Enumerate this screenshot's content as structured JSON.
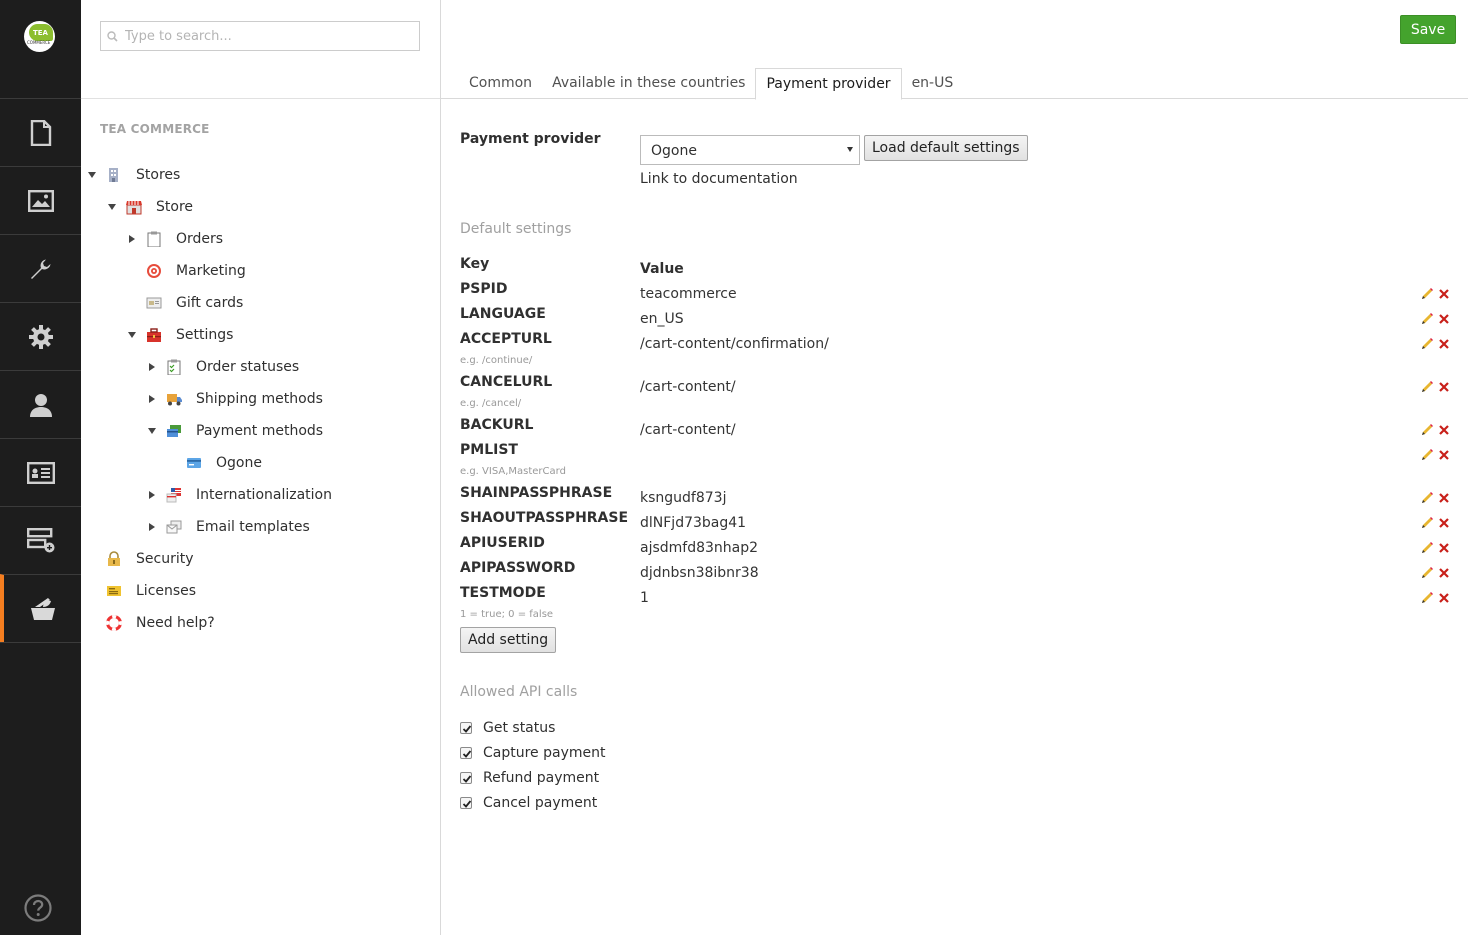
{
  "appbar": {
    "logo_text_top": "TEA",
    "logo_text_bottom": "COMMERCE",
    "items": [
      {
        "name": "content",
        "icon": "document-icon"
      },
      {
        "name": "media",
        "icon": "image-icon"
      },
      {
        "name": "developer",
        "icon": "wrench-icon"
      },
      {
        "name": "settings",
        "icon": "gear-icon"
      },
      {
        "name": "users",
        "icon": "user-icon"
      },
      {
        "name": "members",
        "icon": "id-card-icon"
      },
      {
        "name": "forms",
        "icon": "form-add-icon"
      },
      {
        "name": "tea-commerce",
        "icon": "tea-commerce-icon"
      }
    ],
    "accent_color": "#f57e20"
  },
  "tree": {
    "search_placeholder": "Type to search...",
    "section_title": "TEA COMMERCE",
    "nodes": [
      {
        "label": "Stores",
        "icon": "building-icon",
        "arrow": "down"
      },
      {
        "label": "Store",
        "icon": "store-icon",
        "arrow": "down"
      },
      {
        "label": "Orders",
        "icon": "clipboard-icon",
        "arrow": "right"
      },
      {
        "label": "Marketing",
        "icon": "target-icon",
        "arrow": ""
      },
      {
        "label": "Gift cards",
        "icon": "gift-card-icon",
        "arrow": ""
      },
      {
        "label": "Settings",
        "icon": "toolbox-icon",
        "arrow": "down"
      },
      {
        "label": "Order statuses",
        "icon": "checklist-icon",
        "arrow": "right"
      },
      {
        "label": "Shipping methods",
        "icon": "truck-icon",
        "arrow": "right"
      },
      {
        "label": "Payment methods",
        "icon": "credit-cards-icon",
        "arrow": "down"
      },
      {
        "label": "Ogone",
        "icon": "credit-card-icon",
        "arrow": ""
      },
      {
        "label": "Internationalization",
        "icon": "flag-icon",
        "arrow": "right"
      },
      {
        "label": "Email templates",
        "icon": "email-templates-icon",
        "arrow": "right"
      },
      {
        "label": "Security",
        "icon": "lock-icon",
        "arrow": ""
      },
      {
        "label": "Licenses",
        "icon": "license-icon",
        "arrow": ""
      },
      {
        "label": "Need help?",
        "icon": "lifebuoy-icon",
        "arrow": ""
      }
    ]
  },
  "header": {
    "save_label": "Save",
    "tabs": [
      "Common",
      "Available in these countries",
      "Payment provider",
      "en-US"
    ],
    "active_tab": "Payment provider"
  },
  "provider": {
    "label": "Payment provider",
    "selected": "Ogone",
    "load_defaults_label": "Load default settings",
    "doc_link": "Link to documentation"
  },
  "settings": {
    "section_title": "Default settings",
    "key_header": "Key",
    "value_header": "Value",
    "rows": [
      {
        "key": "PSPID",
        "value": "teacommerce",
        "hint": ""
      },
      {
        "key": "LANGUAGE",
        "value": "en_US",
        "hint": ""
      },
      {
        "key": "ACCEPTURL",
        "value": "/cart-content/confirmation/",
        "hint": "e.g. /continue/"
      },
      {
        "key": "CANCELURL",
        "value": "/cart-content/",
        "hint": "e.g. /cancel/"
      },
      {
        "key": "BACKURL",
        "value": "/cart-content/",
        "hint": ""
      },
      {
        "key": "PMLIST",
        "value": "",
        "hint": "e.g. VISA,MasterCard"
      },
      {
        "key": "SHAINPASSPHRASE",
        "value": "ksngudf873j",
        "hint": ""
      },
      {
        "key": "SHAOUTPASSPHRASE",
        "value": "dlNFjd73bag41",
        "hint": ""
      },
      {
        "key": "APIUSERID",
        "value": "ajsdmfd83nhap2",
        "hint": ""
      },
      {
        "key": "APIPASSWORD",
        "value": "djdnbsn38ibnr38",
        "hint": ""
      },
      {
        "key": "TESTMODE",
        "value": "1",
        "hint": "1 = true; 0 = false"
      }
    ],
    "add_label": "Add setting",
    "edit_icon": "pencil-icon",
    "delete_icon": "delete-x-icon"
  },
  "api": {
    "section_title": "Allowed API calls",
    "calls": [
      {
        "label": "Get status",
        "checked": true
      },
      {
        "label": "Capture payment",
        "checked": true
      },
      {
        "label": "Refund payment",
        "checked": true
      },
      {
        "label": "Cancel payment",
        "checked": true
      }
    ]
  }
}
